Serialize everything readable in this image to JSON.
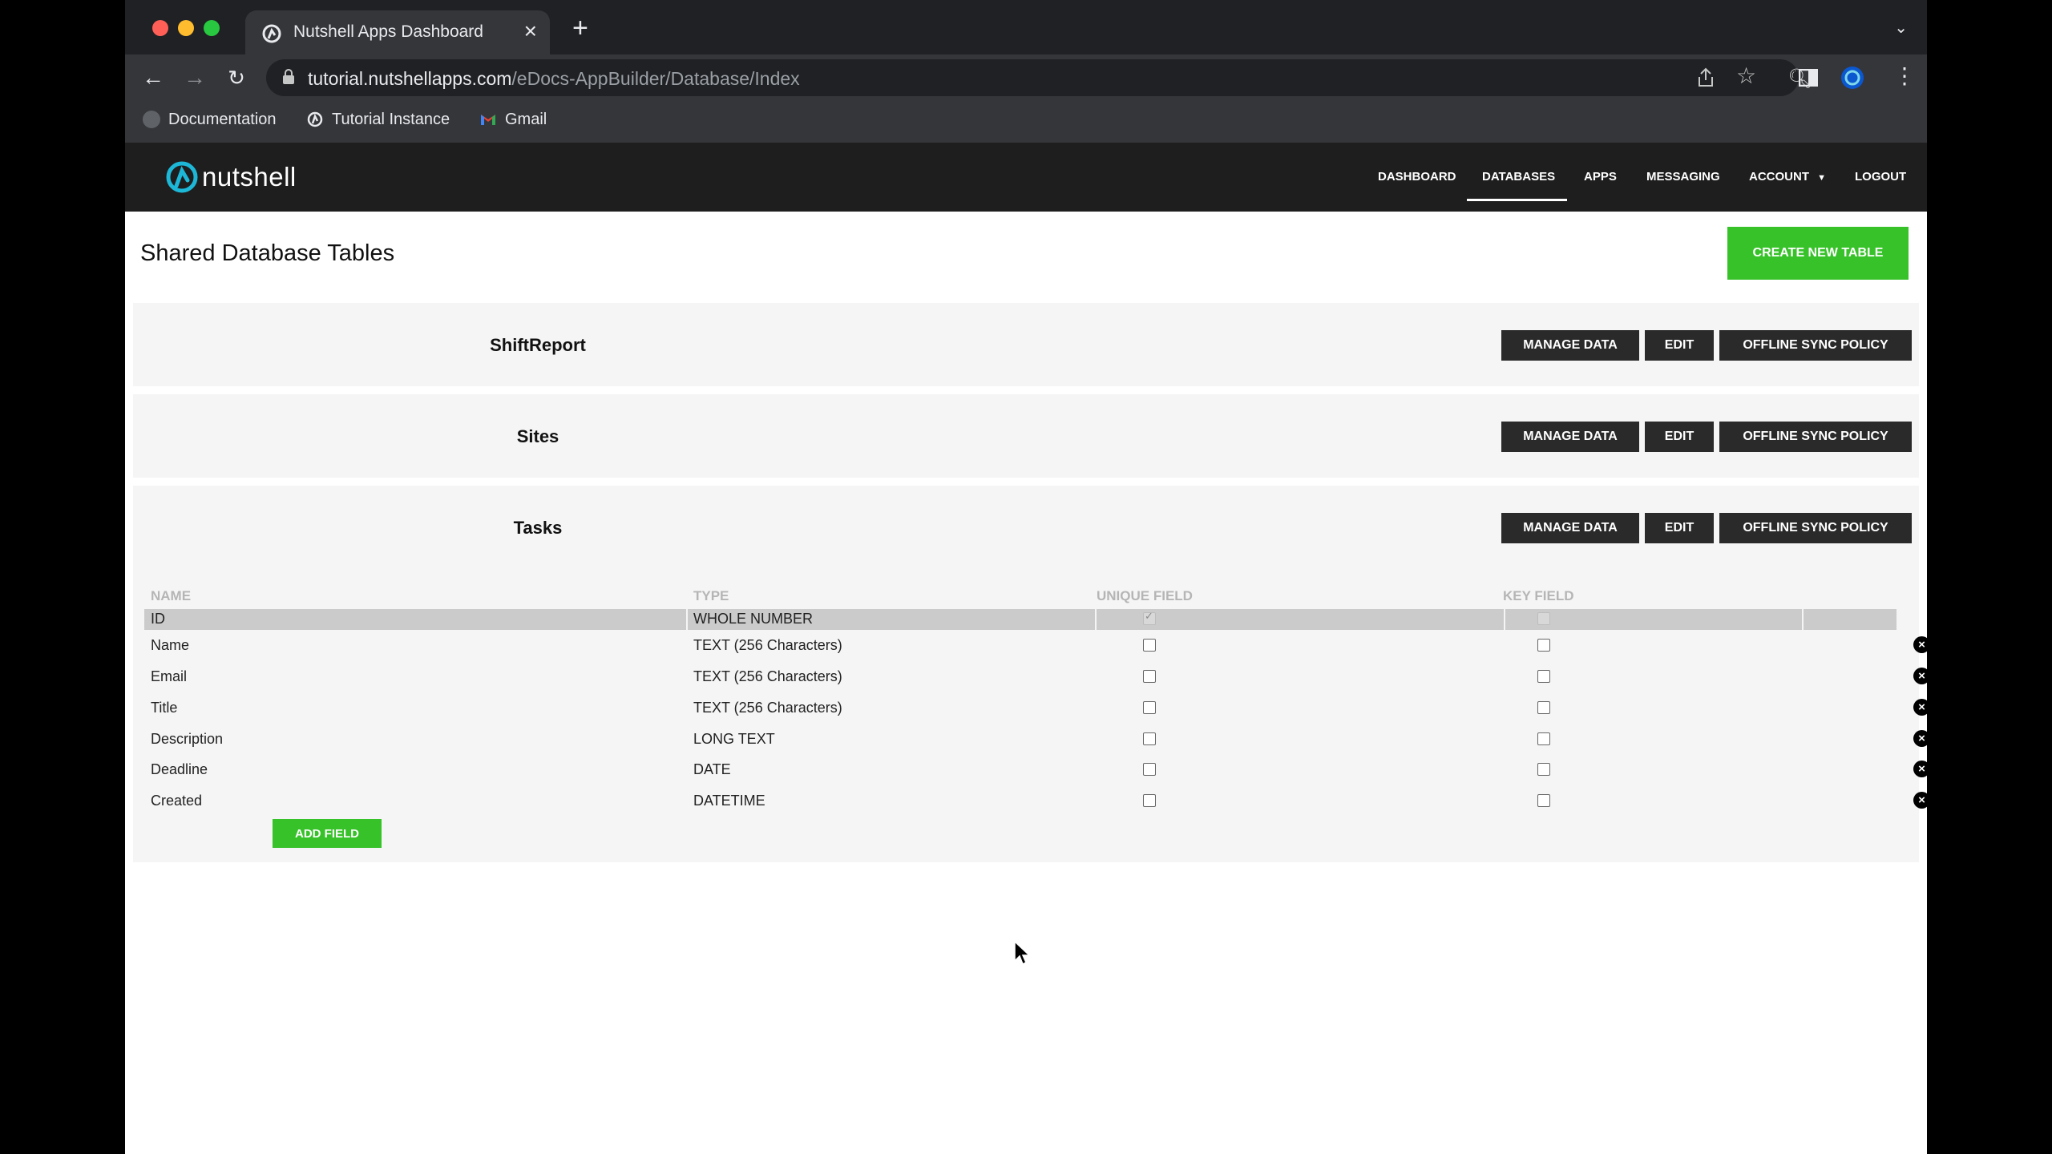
{
  "browser": {
    "tab_title": "Nutshell Apps Dashboard",
    "url_host": "tutorial.nutshellapps.com",
    "url_path": "/eDocs-AppBuilder/Database/Index",
    "bookmarks": [
      "Documentation",
      "Tutorial Instance",
      "Gmail"
    ]
  },
  "app": {
    "logo_text": "nutshell",
    "nav": [
      "DASHBOARD",
      "DATABASES",
      "APPS",
      "MESSAGING",
      "ACCOUNT",
      "LOGOUT"
    ],
    "active_nav": "DATABASES"
  },
  "page": {
    "title": "Shared Database Tables",
    "create_button": "CREATE NEW TABLE"
  },
  "tables": [
    {
      "name": "ShiftReport",
      "buttons": [
        "MANAGE DATA",
        "EDIT",
        "OFFLINE SYNC POLICY"
      ]
    },
    {
      "name": "Sites",
      "buttons": [
        "MANAGE DATA",
        "EDIT",
        "OFFLINE SYNC POLICY"
      ]
    },
    {
      "name": "Tasks",
      "buttons": [
        "MANAGE DATA",
        "EDIT",
        "OFFLINE SYNC POLICY"
      ]
    }
  ],
  "fields_table": {
    "headers": [
      "NAME",
      "TYPE",
      "UNIQUE FIELD",
      "KEY FIELD"
    ],
    "rows": [
      {
        "name": "ID",
        "type": "WHOLE NUMBER",
        "unique": true,
        "key": true,
        "highlighted": true
      },
      {
        "name": "Name",
        "type": "TEXT (256 Characters)",
        "unique": false,
        "key": false
      },
      {
        "name": "Email",
        "type": "TEXT (256 Characters)",
        "unique": false,
        "key": false
      },
      {
        "name": "Title",
        "type": "TEXT (256 Characters)",
        "unique": false,
        "key": false
      },
      {
        "name": "Description",
        "type": "LONG TEXT",
        "unique": false,
        "key": false
      },
      {
        "name": "Deadline",
        "type": "DATE",
        "unique": false,
        "key": false
      },
      {
        "name": "Created",
        "type": "DATETIME",
        "unique": false,
        "key": false
      }
    ],
    "add_button": "ADD FIELD"
  },
  "colors": {
    "accent_green": "#37c22a",
    "header_bg": "#1e1e1e",
    "logo_teal": "#1db8d8"
  }
}
